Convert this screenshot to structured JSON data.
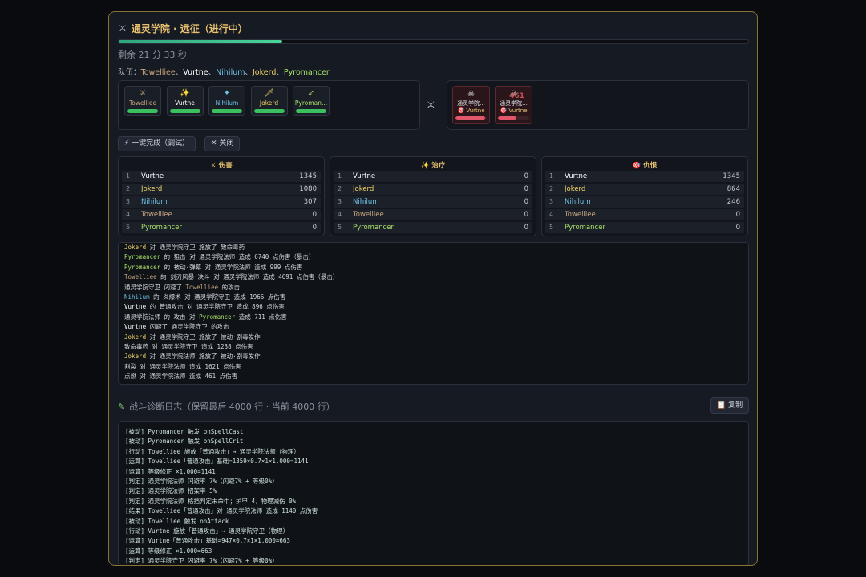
{
  "header": {
    "title": "通灵学院 · 远征（进行中）",
    "progress": 0.26,
    "remaining": "剩余 21 分 33 秒"
  },
  "team": {
    "label": "队伍：",
    "members": [
      {
        "name": "Towelliee",
        "sep": "、",
        "color": "#c7a680"
      },
      {
        "name": "Vurtne",
        "sep": "、",
        "color": "#ffffff"
      },
      {
        "name": "Nihilum",
        "sep": "、",
        "color": "#6fc3e8"
      },
      {
        "name": "Jokerd",
        "sep": "、",
        "color": "#f0d46a"
      },
      {
        "name": "Pyromancer",
        "sep": "",
        "color": "#a8e06b"
      }
    ]
  },
  "party_cards": [
    {
      "name": "Towelliee",
      "icon": "crossed-swords-icon",
      "glyph": "⚔",
      "color": "#c7a680",
      "hp": 1.0
    },
    {
      "name": "Vurtne",
      "icon": "sparkles-icon",
      "glyph": "✨",
      "color": "#ffffff",
      "hp": 1.0
    },
    {
      "name": "Nihilum",
      "icon": "mage-icon",
      "glyph": "✦",
      "color": "#6fc3e8",
      "hp": 1.0
    },
    {
      "name": "Jokerd",
      "icon": "dagger-icon",
      "glyph": "🗡",
      "color": "#f0d46a",
      "hp": 1.0
    },
    {
      "name": "Pyroman...",
      "icon": "bow-icon",
      "glyph": "➶",
      "color": "#a8e06b",
      "hp": 1.0
    }
  ],
  "enemy_cards": [
    {
      "name": "通灵学院...",
      "icon": "skull-crossbones-icon",
      "glyph": "☠",
      "target": "🎯 Vurtne",
      "hp": 0.95,
      "damage": ""
    },
    {
      "name": "通灵学院...",
      "icon": "skull-crossbones-icon",
      "glyph": "☠",
      "target": "🎯 Vurtne",
      "hp": 0.6,
      "damage": "461"
    }
  ],
  "buttons": {
    "complete": "⚡ 一键完成（调试）",
    "close": "✕ 关闭",
    "copy": "📋 复制"
  },
  "rankings": [
    {
      "title": "⚔ 伤害",
      "rows": [
        {
          "rank": "1",
          "name": "Vurtne",
          "value": "1345",
          "color": "#ffffff"
        },
        {
          "rank": "2",
          "name": "Jokerd",
          "value": "1080",
          "color": "#f0d46a"
        },
        {
          "rank": "3",
          "name": "Nihilum",
          "value": "307",
          "color": "#6fc3e8"
        },
        {
          "rank": "4",
          "name": "Towelliee",
          "value": "0",
          "color": "#c7a680"
        },
        {
          "rank": "5",
          "name": "Pyromancer",
          "value": "0",
          "color": "#a8e06b"
        }
      ]
    },
    {
      "title": "✨ 治疗",
      "rows": [
        {
          "rank": "1",
          "name": "Vurtne",
          "value": "0",
          "color": "#ffffff"
        },
        {
          "rank": "2",
          "name": "Jokerd",
          "value": "0",
          "color": "#f0d46a"
        },
        {
          "rank": "3",
          "name": "Nihilum",
          "value": "0",
          "color": "#6fc3e8"
        },
        {
          "rank": "4",
          "name": "Towelliee",
          "value": "0",
          "color": "#c7a680"
        },
        {
          "rank": "5",
          "name": "Pyromancer",
          "value": "0",
          "color": "#a8e06b"
        }
      ]
    },
    {
      "title": "🎯 仇恨",
      "rows": [
        {
          "rank": "1",
          "name": "Vurtne",
          "value": "1345",
          "color": "#ffffff"
        },
        {
          "rank": "2",
          "name": "Jokerd",
          "value": "864",
          "color": "#f0d46a"
        },
        {
          "rank": "3",
          "name": "Nihilum",
          "value": "246",
          "color": "#6fc3e8"
        },
        {
          "rank": "4",
          "name": "Towelliee",
          "value": "0",
          "color": "#c7a680"
        },
        {
          "rank": "5",
          "name": "Pyromancer",
          "value": "0",
          "color": "#a8e06b"
        }
      ]
    }
  ],
  "combat_log": [
    [
      {
        "t": "Jokerd",
        "c": "#f0d46a"
      },
      {
        "t": " 对 通灵学院守卫 施放了 致命毒药"
      }
    ],
    [
      {
        "t": "Pyromancer",
        "c": "#a8e06b"
      },
      {
        "t": " 的 狙击 对 通灵学院法师 造成 6740 点伤害（暴击）"
      }
    ],
    [
      {
        "t": "Pyromancer",
        "c": "#a8e06b"
      },
      {
        "t": " 的 被动·弹幕 对 通灵学院法师 造成 999 点伤害"
      }
    ],
    [
      {
        "t": "Towelliee",
        "c": "#c7a680"
      },
      {
        "t": " 的 剑刃风暴·决斗 对 通灵学院法师 造成 4691 点伤害（暴击）"
      }
    ],
    [
      {
        "t": "通灵学院守卫 闪避了 "
      },
      {
        "t": "Towelliee",
        "c": "#c7a680"
      },
      {
        "t": " 的攻击"
      }
    ],
    [
      {
        "t": "Nihilum",
        "c": "#6fc3e8"
      },
      {
        "t": " 的 炎爆术 对 通灵学院守卫 造成 1966 点伤害"
      }
    ],
    [
      {
        "t": "Vurtne",
        "c": "#ffffff"
      },
      {
        "t": " 的 普通攻击 对 通灵学院守卫 造成 896 点伤害"
      }
    ],
    [
      {
        "t": "通灵学院法师 的 攻击 对 "
      },
      {
        "t": "Pyromancer",
        "c": "#a8e06b"
      },
      {
        "t": " 造成 711 点伤害"
      }
    ],
    [
      {
        "t": "Vurtne",
        "c": "#ffffff"
      },
      {
        "t": " 闪避了 通灵学院守卫 的攻击"
      }
    ],
    [
      {
        "t": "Jokerd",
        "c": "#f0d46a"
      },
      {
        "t": " 对 通灵学院守卫 施放了 被动·剧毒发作"
      }
    ],
    [
      {
        "t": "致命毒药 对 通灵学院守卫 造成 1238 点伤害"
      }
    ],
    [
      {
        "t": "Jokerd",
        "c": "#f0d46a"
      },
      {
        "t": " 对 通灵学院法师 施放了 被动·剧毒发作"
      }
    ],
    [
      {
        "t": "割裂 对 通灵学院法师 造成 1621 点伤害"
      }
    ],
    [
      {
        "t": "点燃 对 通灵学院法师 造成 461 点伤害"
      }
    ]
  ],
  "diagnostics": {
    "title": "战斗诊断日志（保留最后 4000 行 · 当前 4000 行）",
    "icon": "pencil-icon",
    "lines": [
      "[被动] Pyromancer 触发 onSpellCast",
      "[被动] Pyromancer 触发 onSpellCrit",
      "[行动] Towelliee 施放「普通攻击」→ 通灵学院法师（物理）",
      "[运算] Towelliee「普通攻击」基础=1359×0.7×1×1.000=1141",
      "[运算] 等级修正 ×1.000=1141",
      "[判定] 通灵学院法师 闪避率 7%（闪避7% + 等级0%）",
      "[判定] 通灵学院法师 招架率 5%",
      "[判定] 通灵学院法师 格挡判定未命中；护甲 4，物理减伤 0%",
      "[结果] Towelliee「普通攻击」对 通灵学院法师 造成 1140 点伤害",
      "[被动] Towelliee 触发 onAttack",
      "[行动] Vurtne 施放「普通攻击」→ 通灵学院守卫（物理）",
      "[运算] Vurtne「普通攻击」基础=947×0.7×1×1.000=663",
      "[运算] 等级修正 ×1.000=663",
      "[判定] 通灵学院守卫 闪避率 7%（闪避7% + 等级0%）"
    ]
  }
}
